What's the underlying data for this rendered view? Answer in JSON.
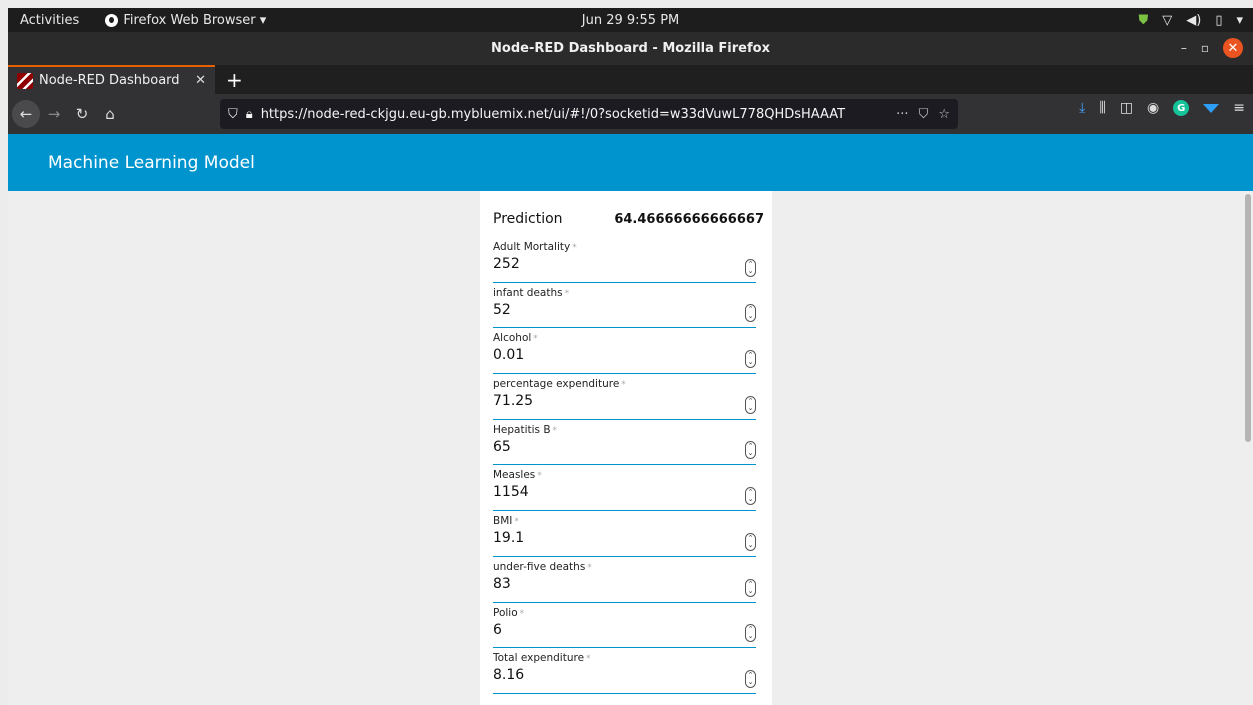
{
  "system": {
    "activities": "Activities",
    "app_menu": "Firefox Web Browser ▾",
    "clock": "Jun 29  9:55 PM"
  },
  "window": {
    "title": "Node-RED Dashboard - Mozilla Firefox"
  },
  "tabs": [
    {
      "label": "Node-RED Dashboard"
    }
  ],
  "navbar": {
    "url": "https://node-red-ckjgu.eu-gb.mybluemix.net/ui/#!/0?socketid=w33dVuwL778QHDsHAAAT"
  },
  "dashboard": {
    "header_title": "Machine Learning Model",
    "prediction_label": "Prediction",
    "prediction_value": "64.46666666666667",
    "fields": [
      {
        "label": "Adult Mortality",
        "value": "252"
      },
      {
        "label": "infant deaths",
        "value": "52"
      },
      {
        "label": "Alcohol",
        "value": "0.01"
      },
      {
        "label": "percentage expenditure",
        "value": "71.25"
      },
      {
        "label": "Hepatitis B",
        "value": "65"
      },
      {
        "label": "Measles",
        "value": "1154"
      },
      {
        "label": "BMI",
        "value": "19.1"
      },
      {
        "label": "under-five deaths",
        "value": "83"
      },
      {
        "label": "Polio",
        "value": "6"
      },
      {
        "label": "Total expenditure",
        "value": "8.16"
      }
    ],
    "required_mark": "*"
  },
  "colors": {
    "header_bg": "#0094ce",
    "accent": "#0094ce",
    "close_button": "#e95420"
  }
}
